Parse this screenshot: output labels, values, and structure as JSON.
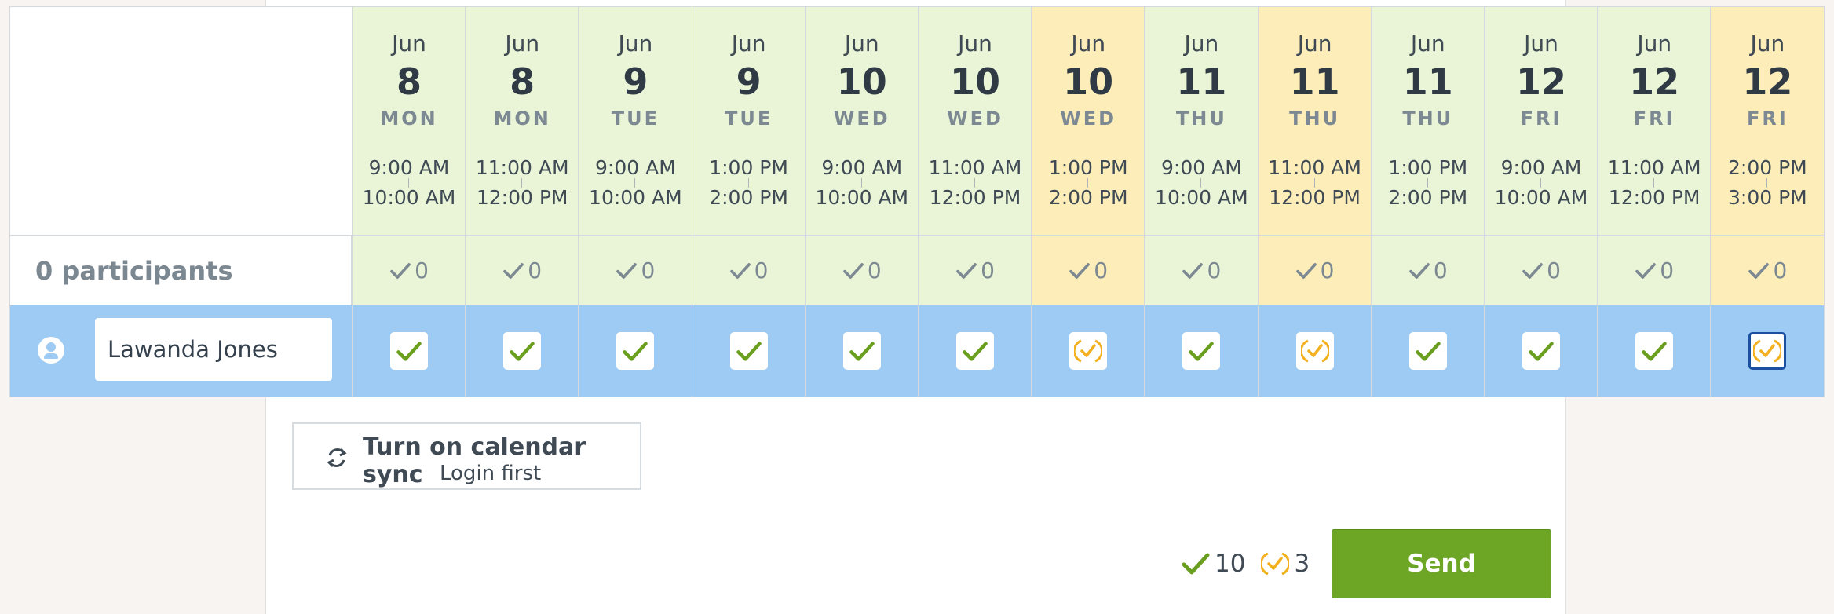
{
  "colors": {
    "available_green": "#e9f5d6",
    "if_needed_yellow": "#fdeeb9",
    "row_blue": "#9ecbf4",
    "check_green": "#6a9e1f",
    "ifneeded_orange": "#f3b01f",
    "send_green": "#6da624"
  },
  "summary_label": "0 participants",
  "participant": {
    "name": "Lawanda Jones",
    "icon": "user-avatar-icon"
  },
  "columns": [
    {
      "month": "Jun",
      "day": "8",
      "weekday": "MON",
      "start": "9:00 AM",
      "end": "10:00 AM",
      "count": "0",
      "status": "yes",
      "kind": "green"
    },
    {
      "month": "Jun",
      "day": "8",
      "weekday": "MON",
      "start": "11:00 AM",
      "end": "12:00 PM",
      "count": "0",
      "status": "yes",
      "kind": "green"
    },
    {
      "month": "Jun",
      "day": "9",
      "weekday": "TUE",
      "start": "9:00 AM",
      "end": "10:00 AM",
      "count": "0",
      "status": "yes",
      "kind": "green"
    },
    {
      "month": "Jun",
      "day": "9",
      "weekday": "TUE",
      "start": "1:00 PM",
      "end": "2:00 PM",
      "count": "0",
      "status": "yes",
      "kind": "green"
    },
    {
      "month": "Jun",
      "day": "10",
      "weekday": "WED",
      "start": "9:00 AM",
      "end": "10:00 AM",
      "count": "0",
      "status": "yes",
      "kind": "green"
    },
    {
      "month": "Jun",
      "day": "10",
      "weekday": "WED",
      "start": "11:00 AM",
      "end": "12:00 PM",
      "count": "0",
      "status": "yes",
      "kind": "green"
    },
    {
      "month": "Jun",
      "day": "10",
      "weekday": "WED",
      "start": "1:00 PM",
      "end": "2:00 PM",
      "count": "0",
      "status": "ifneeded",
      "kind": "yellow"
    },
    {
      "month": "Jun",
      "day": "11",
      "weekday": "THU",
      "start": "9:00 AM",
      "end": "10:00 AM",
      "count": "0",
      "status": "yes",
      "kind": "green"
    },
    {
      "month": "Jun",
      "day": "11",
      "weekday": "THU",
      "start": "11:00 AM",
      "end": "12:00 PM",
      "count": "0",
      "status": "ifneeded",
      "kind": "yellow"
    },
    {
      "month": "Jun",
      "day": "11",
      "weekday": "THU",
      "start": "1:00 PM",
      "end": "2:00 PM",
      "count": "0",
      "status": "yes",
      "kind": "green"
    },
    {
      "month": "Jun",
      "day": "12",
      "weekday": "FRI",
      "start": "9:00 AM",
      "end": "10:00 AM",
      "count": "0",
      "status": "yes",
      "kind": "green"
    },
    {
      "month": "Jun",
      "day": "12",
      "weekday": "FRI",
      "start": "11:00 AM",
      "end": "12:00 PM",
      "count": "0",
      "status": "yes",
      "kind": "green"
    },
    {
      "month": "Jun",
      "day": "12",
      "weekday": "FRI",
      "start": "2:00 PM",
      "end": "3:00 PM",
      "count": "0",
      "status": "ifneeded",
      "kind": "yellow",
      "focused": true
    }
  ],
  "sync": {
    "title": "Turn on calendar sync",
    "subtitle": "Login first",
    "icon": "sync-icon"
  },
  "totals": {
    "yes_count": "10",
    "ifneeded_count": "3"
  },
  "send_label": "Send"
}
